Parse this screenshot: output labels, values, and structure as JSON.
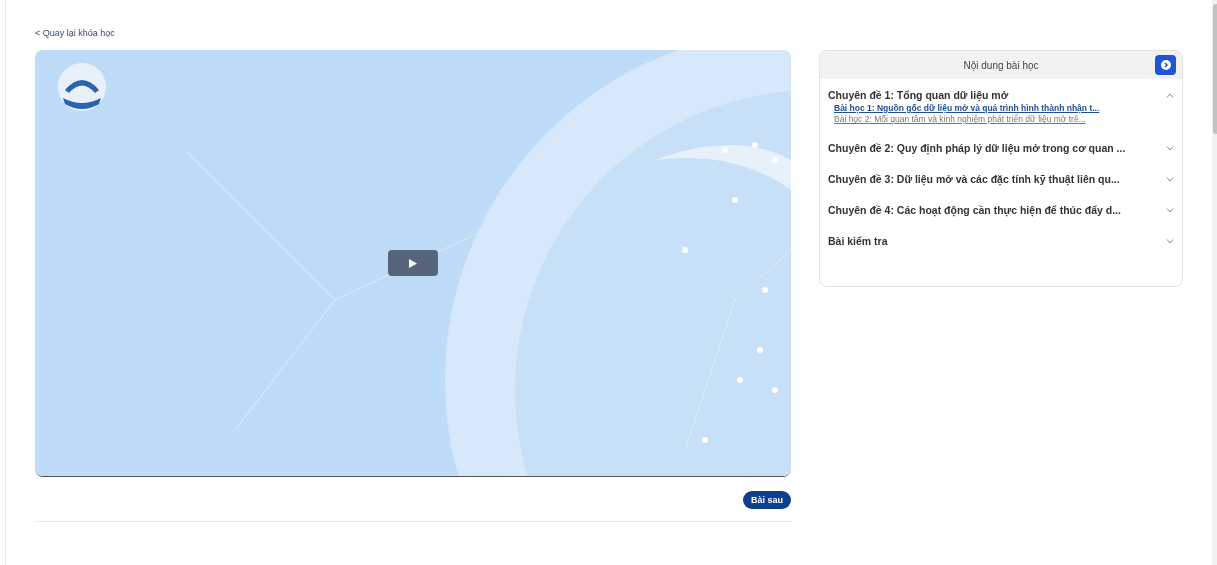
{
  "back_link": "< Quay lại khóa học",
  "next_button": "Bài sau",
  "panel": {
    "title": "Nội dung bài học",
    "topics": [
      {
        "title": "Chuyên đề 1: Tổng quan dữ liệu mở",
        "expanded": true,
        "lessons": [
          {
            "title": "Bài học 1: Nguồn gốc dữ liệu mở và quá trình hình thành nhận t...",
            "selected": true
          },
          {
            "title": "Bài học 2: Mối quan tâm và kinh nghiệm phát triển dữ liệu mở trê...",
            "selected": false
          }
        ]
      },
      {
        "title": "Chuyên đề 2: Quy định pháp lý dữ liệu mở trong cơ quan ...",
        "expanded": false
      },
      {
        "title": "Chuyên đề 3: Dữ liệu mở và các đặc tính kỹ thuật liên qu...",
        "expanded": false
      },
      {
        "title": "Chuyên đề 4: Các hoạt động cần thực hiện để thúc đẩy d...",
        "expanded": false
      },
      {
        "title": "Bài kiểm tra",
        "expanded": false
      }
    ]
  }
}
